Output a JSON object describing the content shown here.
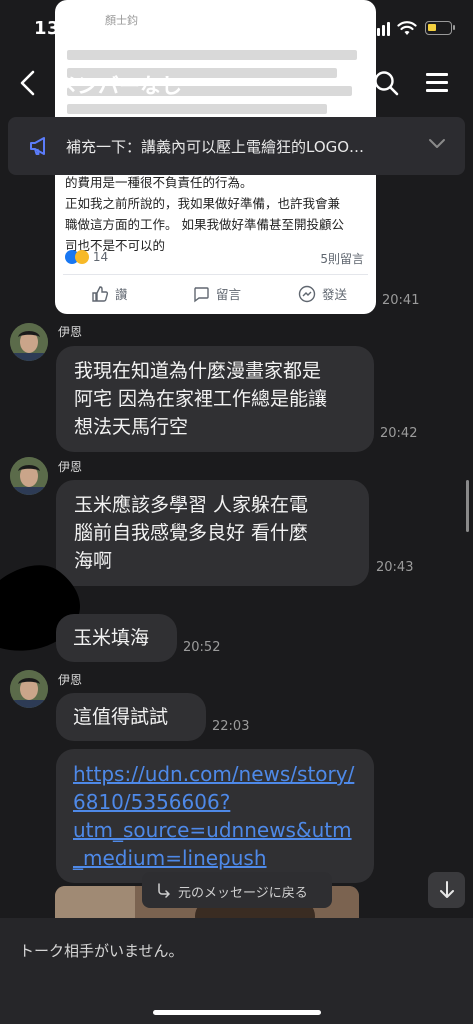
{
  "status_bar": {
    "time": "13:42"
  },
  "header": {
    "title": "メンバーなし"
  },
  "announcement": {
    "text": "補充一下：講義內可以壓上電繪狂的LOGO…"
  },
  "shared_post": {
    "author": "顏士鈞",
    "body_line1": "的費用是一種很不負責任的行為。",
    "body_line2": "正如我之前所說的，我如果做好準備，也許我會兼",
    "body_line3": "職做這方面的工作。 如果我做好準備甚至開投顧公",
    "body_line4": "司也不是不可以的",
    "reaction_count": "14",
    "comment_count": "5則留言",
    "like_label": "讚",
    "comment_label": "留言",
    "share_label": "發送",
    "time": "20:41"
  },
  "messages": [
    {
      "sender": "伊恩",
      "line1": "我現在知道為什麼漫畫家都是",
      "line2": "阿宅 因為在家裡工作總是能讓",
      "line3": "想法天馬行空",
      "time": "20:42"
    },
    {
      "sender": "伊恩",
      "line1": "玉米應該多學習 人家躲在電",
      "line2": "腦前自我感覺多良好 看什麼",
      "line3": "海啊",
      "time": "20:43"
    },
    {
      "sender": "",
      "line1": "玉米填海",
      "time": "20:52"
    },
    {
      "sender": "伊恩",
      "line1": "這值得試試",
      "time": "22:03"
    },
    {
      "line1": "https://udn.com/news/story/",
      "line2": "6810/5356606?",
      "line3": "utm_source=udnnews&utm",
      "line4": "_medium=linepush"
    }
  ],
  "back_to_original": "元のメッセージに戻る",
  "footer": {
    "text": "トーク相手がいません。"
  },
  "colors": {
    "background": "#1b1b1d",
    "bubble": "#303033",
    "link": "#4e89e8",
    "battery": "#f4d03f"
  }
}
